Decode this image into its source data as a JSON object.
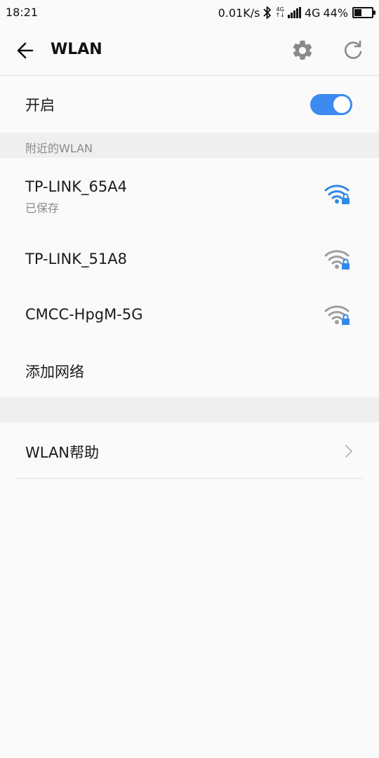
{
  "status_bar": {
    "time": "18:21",
    "speed": "0.01K/s",
    "network_small_top": "4G",
    "network_small_bottom": "↑↓",
    "network_type": "4G",
    "battery": "44%",
    "battery_level": 0.44
  },
  "toolbar": {
    "title": "WLAN"
  },
  "wlan_toggle": {
    "label": "开启",
    "on": true
  },
  "nearby_header": "附近的WLAN",
  "networks": [
    {
      "ssid": "TP-LINK_65A4",
      "status": "已保存",
      "signal_color": "#2f8ae8",
      "secured": true
    },
    {
      "ssid": "TP-LINK_51A8",
      "status": "",
      "signal_color": "#9e9e9e",
      "secured": true
    },
    {
      "ssid": "CMCC-HpgM-5G",
      "status": "",
      "signal_color": "#9e9e9e",
      "secured": true
    }
  ],
  "add_network": "添加网络",
  "help": "WLAN帮助",
  "colors": {
    "accent": "#3d8bf0",
    "lock": "#2f8ae8"
  }
}
